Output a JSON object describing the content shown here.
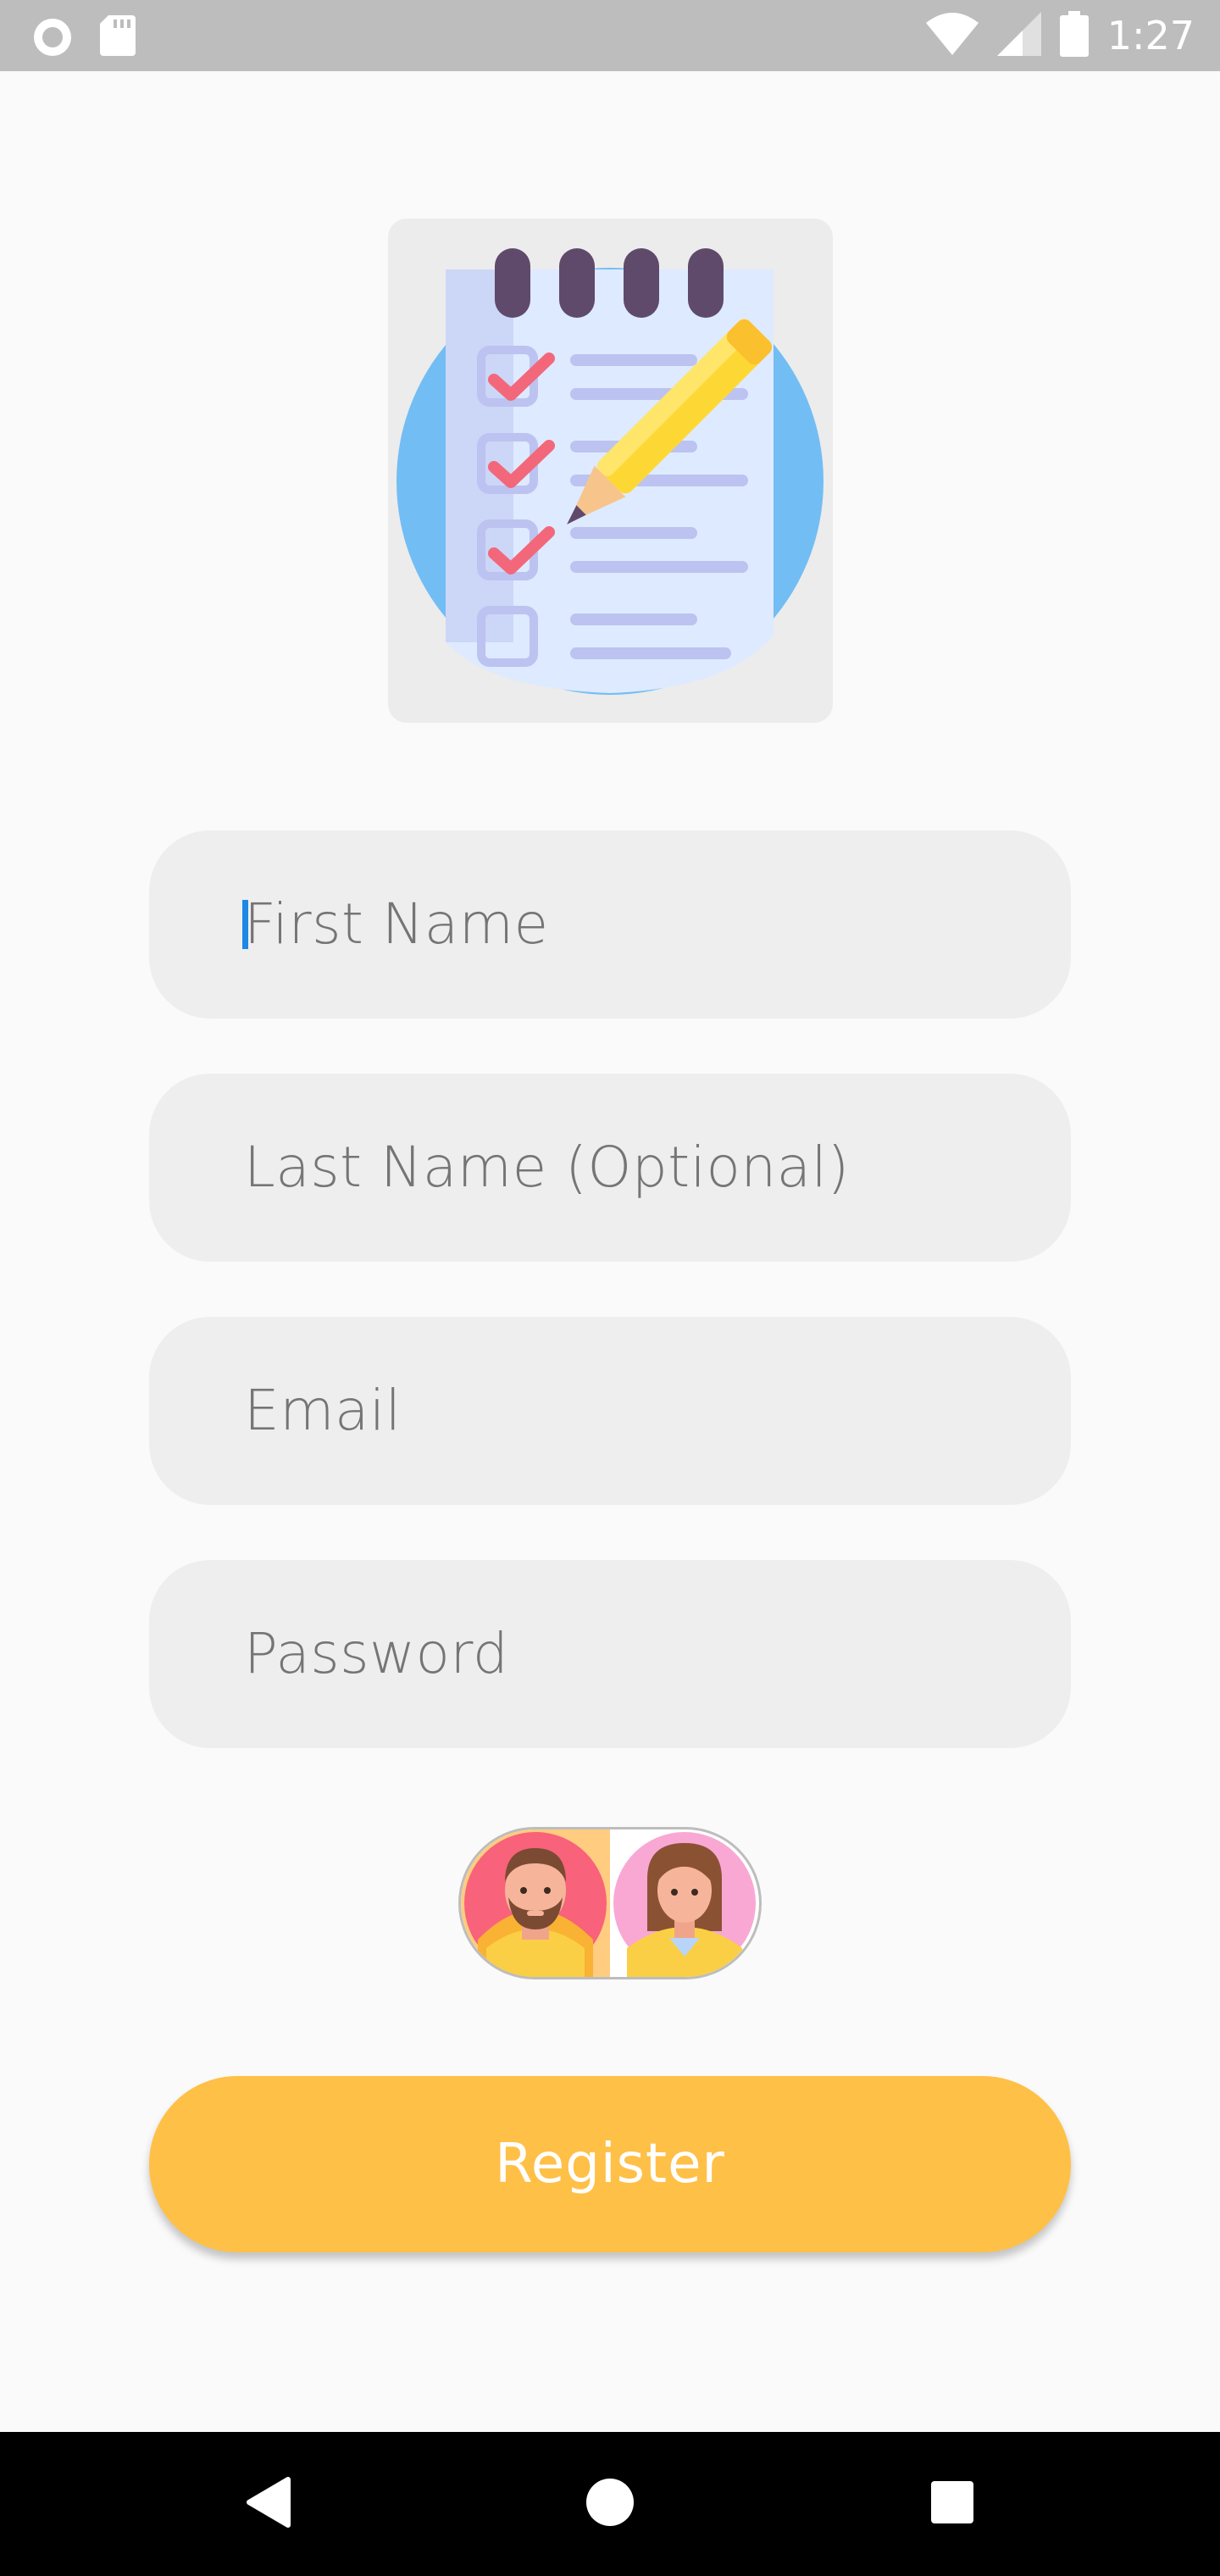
{
  "status_bar": {
    "time": "1:27",
    "icons": [
      "record-icon",
      "sd-card-icon",
      "wifi-icon",
      "signal-icon",
      "battery-icon"
    ]
  },
  "illustration": {
    "icon": "checklist-notepad-icon"
  },
  "form": {
    "first_name": {
      "placeholder": "First Name",
      "value": ""
    },
    "last_name": {
      "placeholder": "Last Name (Optional)",
      "value": ""
    },
    "email": {
      "placeholder": "Email",
      "value": ""
    },
    "password": {
      "placeholder": "Password",
      "value": ""
    }
  },
  "gender_toggle": {
    "options": [
      {
        "icon": "male-avatar-icon",
        "selected": true
      },
      {
        "icon": "female-avatar-icon",
        "selected": false
      }
    ]
  },
  "register_button": {
    "label": "Register"
  },
  "nav_bar": {
    "buttons": [
      "back-icon",
      "home-icon",
      "recents-icon"
    ]
  },
  "colors": {
    "background": "#fafafa",
    "status_bar": "#bdbdbd",
    "field_background": "#eeeeee",
    "placeholder_text": "#757575",
    "accent": "#ffc048",
    "caret": "#1e88e5",
    "nav_bar": "#000000"
  }
}
